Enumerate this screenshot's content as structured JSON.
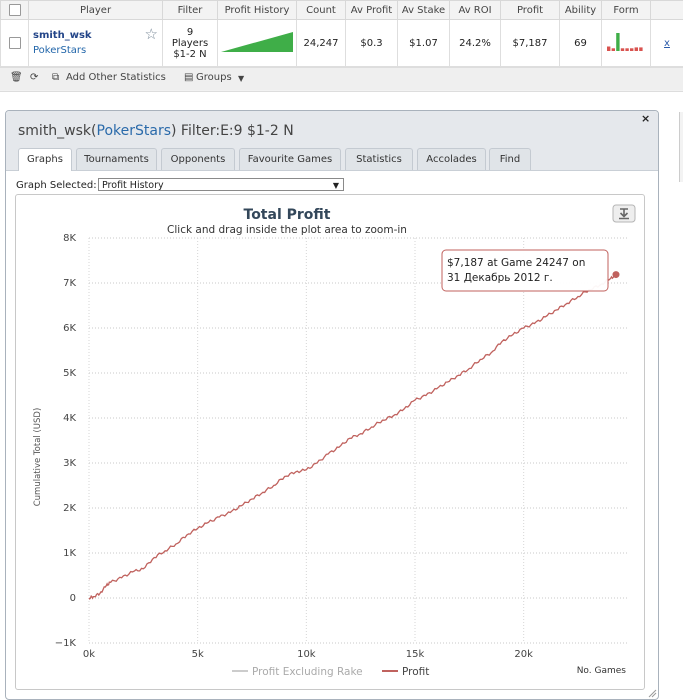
{
  "table": {
    "headers": [
      "",
      "Player",
      "Filter",
      "Profit History",
      "Count",
      "Av Profit",
      "Av Stake",
      "Av ROI",
      "Profit",
      "Ability",
      "Form",
      ""
    ],
    "row": {
      "player_name": "smith_wsk",
      "site": "PokerStars",
      "filter_lines": [
        "9",
        "Players",
        "$1-2 N"
      ],
      "count": "24,247",
      "av_profit": "$0.3",
      "av_stake": "$1.07",
      "av_roi": "24.2%",
      "profit": "$7,187",
      "ability": "69",
      "remove": "x"
    },
    "form_bars": [
      0.25,
      0.15,
      1.0,
      0.15,
      0.15,
      0.15,
      0.2,
      0.2
    ]
  },
  "toolbar": {
    "add_stats_label": "Add Other Statistics",
    "groups_label": "Groups"
  },
  "panel": {
    "title_player": "smith_wsk",
    "title_open_paren": "(",
    "title_site": "PokerStars",
    "title_close_paren": ")",
    "title_filter": " Filter:E:9 $1-2 N",
    "close": "×",
    "tabs": [
      "Graphs",
      "Tournaments",
      "Opponents",
      "Favourite Games",
      "Statistics",
      "Accolades",
      "Find"
    ],
    "active_tab": 0,
    "graph_selected_label": "Graph Selected:",
    "graph_selected_value": "Profit History"
  },
  "chart_data": {
    "type": "line",
    "title": "Total Profit",
    "subtitle": "Click and drag inside the plot area to zoom-in",
    "ylabel": "Cumulative Total (USD)",
    "xlabel": "No. Games",
    "ylim": [
      -1000,
      8000
    ],
    "xlim": [
      0,
      24800
    ],
    "y_ticks": [
      {
        "value": -1000,
        "label": "−1K"
      },
      {
        "value": 0,
        "label": "0"
      },
      {
        "value": 1000,
        "label": "1K"
      },
      {
        "value": 2000,
        "label": "2K"
      },
      {
        "value": 3000,
        "label": "3K"
      },
      {
        "value": 4000,
        "label": "4K"
      },
      {
        "value": 5000,
        "label": "5K"
      },
      {
        "value": 6000,
        "label": "6K"
      },
      {
        "value": 7000,
        "label": "7K"
      },
      {
        "value": 8000,
        "label": "8K"
      }
    ],
    "x_ticks": [
      {
        "value": 0,
        "label": "0k"
      },
      {
        "value": 5000,
        "label": "5k"
      },
      {
        "value": 10000,
        "label": "10k"
      },
      {
        "value": 15000,
        "label": "15k"
      },
      {
        "value": 20000,
        "label": "20k"
      }
    ],
    "grid": true,
    "legend_position": "bottom",
    "series": [
      {
        "name": "Profit Excluding Rake",
        "color": "#cccccc",
        "x": [],
        "y": []
      },
      {
        "name": "Profit",
        "color": "#c0625e",
        "x": [
          0,
          200,
          500,
          800,
          1000,
          1500,
          2000,
          2500,
          3000,
          3500,
          4000,
          4500,
          5000,
          5500,
          6000,
          6500,
          7000,
          7500,
          8000,
          8500,
          9000,
          9500,
          10000,
          10500,
          11000,
          11500,
          12000,
          12500,
          13000,
          13500,
          14000,
          14500,
          15000,
          15500,
          16000,
          16500,
          17000,
          17500,
          18000,
          18500,
          19000,
          19500,
          20000,
          20500,
          21000,
          21500,
          22000,
          22500,
          23000,
          23500,
          24000,
          24247
        ],
        "y": [
          0,
          30,
          100,
          280,
          350,
          450,
          580,
          650,
          900,
          1050,
          1200,
          1400,
          1550,
          1680,
          1800,
          1900,
          2050,
          2200,
          2350,
          2500,
          2700,
          2800,
          2850,
          3000,
          3200,
          3350,
          3550,
          3650,
          3800,
          3950,
          4050,
          4200,
          4400,
          4500,
          4650,
          4800,
          4950,
          5100,
          5300,
          5450,
          5700,
          5850,
          6000,
          6100,
          6250,
          6400,
          6550,
          6700,
          6850,
          6950,
          7100,
          7187
        ]
      }
    ],
    "tooltip": {
      "line1": "$7,187 at Game 24247 on",
      "line2": "31 Декабрь 2012 г."
    }
  }
}
